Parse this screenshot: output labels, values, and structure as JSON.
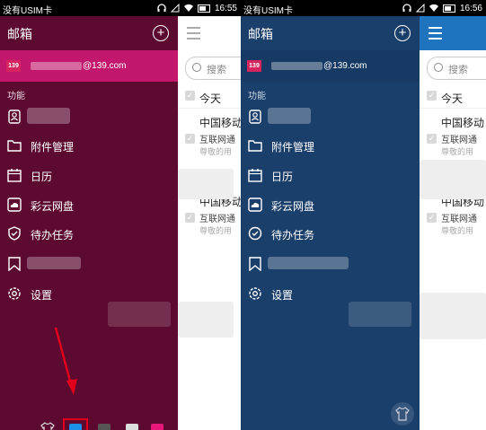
{
  "panels": [
    {
      "status": {
        "carrier": "没有USIM卡",
        "time": "16:55"
      },
      "drawer": {
        "title": "邮箱",
        "account_email": "@139.com",
        "account_badge": "139",
        "section": "功能",
        "menu": [
          "",
          "附件管理",
          "日历",
          "彩云网盘",
          "待办任务",
          "",
          "设置"
        ]
      },
      "content": {
        "search_placeholder": "搜索",
        "group": "今天",
        "mails": [
          {
            "subject": "中国移动",
            "from": "互联网通",
            "preview": "尊敬的用"
          },
          {
            "subject": "中国移动",
            "from": "互联网通",
            "preview": "尊敬的用"
          }
        ]
      }
    },
    {
      "status": {
        "carrier": "没有USIM卡",
        "time": "16:56"
      },
      "drawer": {
        "title": "邮箱",
        "account_email": "@139.com",
        "account_badge": "139",
        "section": "功能",
        "menu": [
          "",
          "附件管理",
          "日历",
          "彩云网盘",
          "待办任务",
          "",
          "设置"
        ]
      },
      "content": {
        "search_placeholder": "搜索",
        "group": "今天",
        "mails": [
          {
            "subject": "中国移动",
            "from": "互联网通",
            "preview": "尊敬的用"
          },
          {
            "subject": "中国移动",
            "from": "互联网通",
            "preview": "尊敬的用"
          }
        ]
      }
    }
  ],
  "themes": [
    {
      "name": "blue",
      "color": "#1e8fe6",
      "selected": true
    },
    {
      "name": "dark-gray",
      "color": "#555555",
      "selected": false
    },
    {
      "name": "light-gray",
      "color": "#dddddd",
      "selected": false
    },
    {
      "name": "pink",
      "color": "#e8177a",
      "selected": false
    }
  ]
}
